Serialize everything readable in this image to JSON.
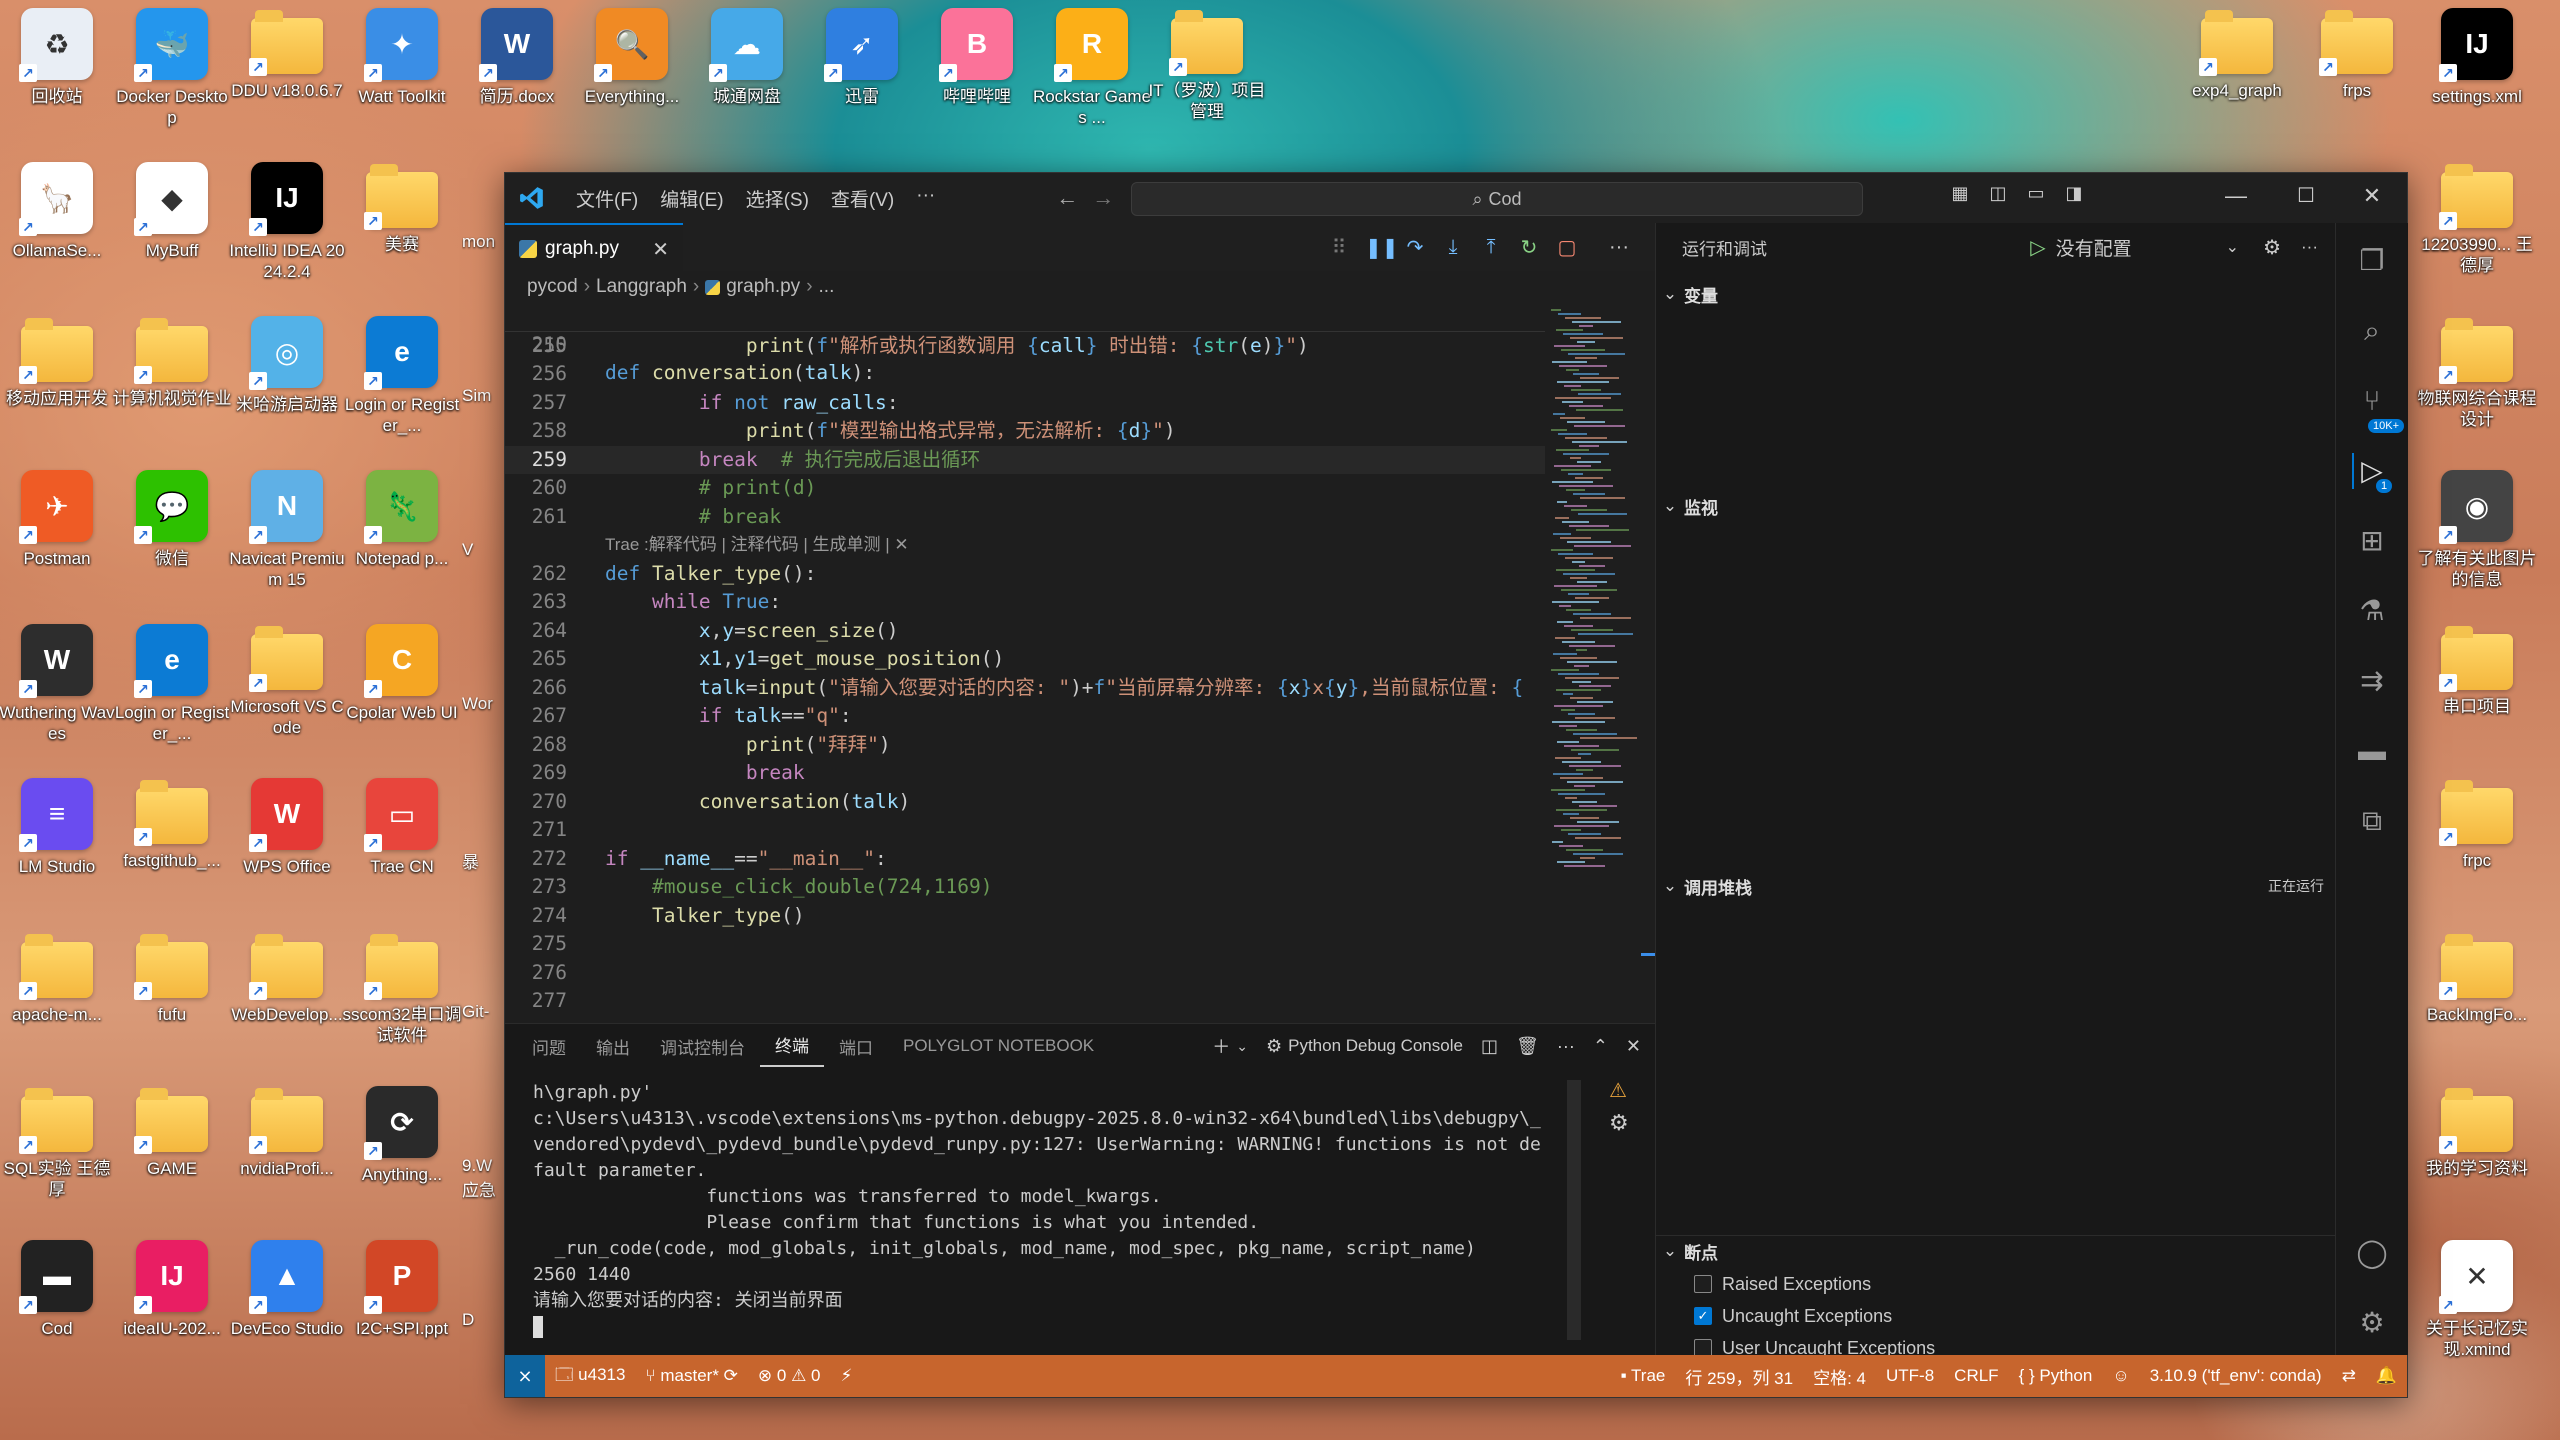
{
  "desktop": {
    "icons": [
      {
        "label": "回收站",
        "color": "#e9eef5",
        "glyph": "♻",
        "folder": false
      },
      {
        "label": "Docker Desktop",
        "color": "#2496ed",
        "glyph": "🐳",
        "folder": false
      },
      {
        "label": "DDU v18.0.6.7",
        "color": "",
        "glyph": "",
        "folder": true
      },
      {
        "label": "Watt Toolkit",
        "color": "#3a8ee6",
        "glyph": "✦",
        "folder": false
      },
      {
        "label": "简历.docx",
        "color": "#2b579a",
        "glyph": "W",
        "folder": false
      },
      {
        "label": "Everything...",
        "color": "#f08a24",
        "glyph": "🔍",
        "folder": false
      },
      {
        "label": "城通网盘",
        "color": "#46a9e8",
        "glyph": "☁",
        "folder": false
      },
      {
        "label": "迅雷",
        "color": "#2f7fe0",
        "glyph": "➶",
        "folder": false
      },
      {
        "label": "哔哩哔哩",
        "color": "#fb7299",
        "glyph": "B",
        "folder": false
      },
      {
        "label": "Rockstar Games ...",
        "color": "#fcaf17",
        "glyph": "R",
        "folder": false
      },
      {
        "label": "IT（罗波）项目管理",
        "color": "",
        "glyph": "",
        "folder": true
      },
      {
        "label": "OllamaSe...",
        "color": "#ffffff",
        "glyph": "🦙",
        "folder": false
      },
      {
        "label": "MyBuff",
        "color": "#ffffff",
        "glyph": "◆",
        "folder": false
      },
      {
        "label": "IntelliJ IDEA 2024.2.4",
        "color": "#000000",
        "glyph": "IJ",
        "folder": false
      },
      {
        "label": "美赛",
        "color": "",
        "glyph": "",
        "folder": true
      },
      {
        "label": "移动应用开发",
        "color": "",
        "glyph": "",
        "folder": true
      },
      {
        "label": "计算机视觉作业",
        "color": "",
        "glyph": "",
        "folder": true
      },
      {
        "label": "米哈游启动器",
        "color": "#53b2e8",
        "glyph": "◎",
        "folder": false
      },
      {
        "label": "Login or Register_...",
        "color": "#0c7bd4",
        "glyph": "e",
        "folder": false
      },
      {
        "label": "Postman",
        "color": "#ef5b25",
        "glyph": "✈",
        "folder": false
      },
      {
        "label": "微信",
        "color": "#2dc100",
        "glyph": "💬",
        "folder": false
      },
      {
        "label": "Navicat Premium 15",
        "color": "#5fb0e6",
        "glyph": "N",
        "folder": false
      },
      {
        "label": "Notepad p...",
        "color": "#7cb342",
        "glyph": "🦎",
        "folder": false
      },
      {
        "label": "Wuthering Waves",
        "color": "#2d2d2d",
        "glyph": "W",
        "folder": false
      },
      {
        "label": "Login or Register_...",
        "color": "#0c7bd4",
        "glyph": "e",
        "folder": false
      },
      {
        "label": "Microsoft VS Code",
        "color": "",
        "glyph": "",
        "folder": true
      },
      {
        "label": "Cpolar Web UI",
        "color": "#f5a623",
        "glyph": "C",
        "folder": false
      },
      {
        "label": "LM Studio",
        "color": "#6a4cf0",
        "glyph": "≡",
        "folder": false
      },
      {
        "label": "fastgithub_...",
        "color": "",
        "glyph": "",
        "folder": true
      },
      {
        "label": "WPS Office",
        "color": "#e53935",
        "glyph": "W",
        "folder": false
      },
      {
        "label": "Trae CN",
        "color": "#e8453c",
        "glyph": "▭",
        "folder": false
      },
      {
        "label": "apache-m...",
        "color": "",
        "glyph": "",
        "folder": true
      },
      {
        "label": "fufu",
        "color": "",
        "glyph": "",
        "folder": true
      },
      {
        "label": "WebDevelop...",
        "color": "",
        "glyph": "",
        "folder": true
      },
      {
        "label": "sscom32串口调试软件",
        "color": "",
        "glyph": "",
        "folder": true
      },
      {
        "label": "SQL实验 王德厚",
        "color": "",
        "glyph": "",
        "folder": true
      },
      {
        "label": "GAME",
        "color": "",
        "glyph": "",
        "folder": true
      },
      {
        "label": "nvidiaProfi...",
        "color": "",
        "glyph": "",
        "folder": true
      },
      {
        "label": "Anything...",
        "color": "#2a2a2a",
        "glyph": "⟳",
        "folder": false
      },
      {
        "label": "Cod",
        "color": "#222222",
        "glyph": "▬",
        "folder": false
      },
      {
        "label": "ideaIU-202...",
        "color": "#e91e63",
        "glyph": "IJ",
        "folder": false
      },
      {
        "label": "DevEco Studio",
        "color": "#2f80ed",
        "glyph": "▲",
        "folder": false
      },
      {
        "label": "I2C+SPI.ppt",
        "color": "#d24726",
        "glyph": "P",
        "folder": false
      }
    ],
    "partial_icons": [
      "mon",
      "Sim",
      "V",
      "Wor",
      "暴",
      "Git-",
      "9.W 应急",
      "D"
    ],
    "right_icons": [
      {
        "label": "exp4_graph",
        "color": "",
        "glyph": "",
        "folder": true
      },
      {
        "label": "frps",
        "color": "",
        "glyph": "",
        "folder": true
      },
      {
        "label": "settings.xml",
        "color": "#000000",
        "glyph": "IJ",
        "folder": false
      },
      {
        "label": "12203990... 王德厚",
        "color": "",
        "glyph": "",
        "folder": true
      },
      {
        "label": "物联网综合课程设计",
        "color": "",
        "glyph": "",
        "folder": true
      },
      {
        "label": "了解有关此图片的信息",
        "color": "#444444",
        "glyph": "◉",
        "folder": false
      },
      {
        "label": "串口项目",
        "color": "",
        "glyph": "",
        "folder": true
      },
      {
        "label": "frpc",
        "color": "",
        "glyph": "",
        "folder": true
      },
      {
        "label": "BackImgFo...",
        "color": "",
        "glyph": "",
        "folder": true
      },
      {
        "label": "我的学习资料",
        "color": "",
        "glyph": "",
        "folder": true
      },
      {
        "label": "关于长记忆实现.xmind",
        "color": "#ffffff",
        "glyph": "✕",
        "folder": false
      }
    ]
  },
  "vscode": {
    "menu": [
      "文件(F)",
      "编辑(E)",
      "选择(S)",
      "查看(V)",
      "···"
    ],
    "search_text": "Cod",
    "tab": {
      "name": "graph.py",
      "close": "✕"
    },
    "breadcrumb": [
      "pycod",
      "Langgraph",
      "graph.py",
      "..."
    ],
    "sticky_line": {
      "ln": "210",
      "code": "def conversation(talk):"
    },
    "lines": [
      {
        "ln": "255",
        "html": "            <span class='fn'>print</span>(<span class='kw'>f</span><span class='str'>\"解析或执行函数调用 </span><span class='kw'>{</span><span class='var'>call</span><span class='kw'>}</span><span class='str'> 时出错: </span><span class='kw'>{</span><span class='cls'>str</span>(<span class='var'>e</span>)<span class='kw'>}</span><span class='str'>\"</span>)"
      },
      {
        "ln": "256",
        "html": ""
      },
      {
        "ln": "257",
        "html": "        <span class='ctl'>if</span> <span class='kw'>not</span> <span class='var'>raw_calls</span>:"
      },
      {
        "ln": "258",
        "html": "            <span class='fn'>print</span>(<span class='kw'>f</span><span class='str'>\"模型输出格式异常，无法解析: </span><span class='kw'>{</span><span class='var'>d</span><span class='kw'>}</span><span class='str'>\"</span>)"
      },
      {
        "ln": "259",
        "html": "        <span class='ctl'>break</span>  <span class='cmt'># 执行完成后退出循环</span>",
        "current": true
      },
      {
        "ln": "260",
        "html": "        <span class='cmt'># print(d)</span>"
      },
      {
        "ln": "261",
        "html": "        <span class='cmt'># break</span>"
      },
      {
        "ln": "",
        "lens": "Trae :解释代码 | 注释代码 | 生成单测 | ✕"
      },
      {
        "ln": "262",
        "html": "<span class='kw'>def</span> <span class='fn'>Talker_type</span>():"
      },
      {
        "ln": "263",
        "html": "    <span class='ctl'>while</span> <span class='kw'>True</span>:"
      },
      {
        "ln": "264",
        "html": "        <span class='var'>x</span>,<span class='var'>y</span>=<span class='fn'>screen_size</span>()"
      },
      {
        "ln": "265",
        "html": "        <span class='var'>x1</span>,<span class='var'>y1</span>=<span class='fn'>get_mouse_position</span>()"
      },
      {
        "ln": "266",
        "html": "        <span class='var'>talk</span>=<span class='fn'>input</span>(<span class='str'>\"请输入您要对话的内容: \"</span>)+<span class='kw'>f</span><span class='str'>\"当前屏幕分辨率: </span><span class='kw'>{</span><span class='var'>x</span><span class='kw'>}</span><span class='str'>x</span><span class='kw'>{</span><span class='var'>y</span><span class='kw'>}</span><span class='str'>,当前鼠标位置: </span><span class='kw'>{</span>"
      },
      {
        "ln": "267",
        "html": "        <span class='ctl'>if</span> <span class='var'>talk</span>==<span class='str'>\"q\"</span>:"
      },
      {
        "ln": "268",
        "html": "            <span class='fn'>print</span>(<span class='str'>\"拜拜\"</span>)"
      },
      {
        "ln": "269",
        "html": "            <span class='ctl'>break</span>"
      },
      {
        "ln": "270",
        "html": "        <span class='fn'>conversation</span>(<span class='var'>talk</span>)"
      },
      {
        "ln": "271",
        "html": ""
      },
      {
        "ln": "272",
        "html": "<span class='ctl'>if</span> <span class='var'>__name__</span>==<span class='str'>\"__main__\"</span>:"
      },
      {
        "ln": "273",
        "html": "    <span class='cmt'>#mouse_click_double(724,1169)</span>"
      },
      {
        "ln": "274",
        "html": "    <span class='fn'>Talker_type</span>()"
      },
      {
        "ln": "275",
        "html": ""
      },
      {
        "ln": "276",
        "html": ""
      },
      {
        "ln": "277",
        "html": ""
      }
    ],
    "panel_tabs": [
      "问题",
      "输出",
      "调试控制台",
      "终端",
      "端口",
      "POLYGLOT NOTEBOOK"
    ],
    "panel_active": "终端",
    "debug_console_label": "Python Debug Console",
    "terminal_lines": [
      "h\\graph.py'",
      "c:\\Users\\u4313\\.vscode\\extensions\\ms-python.debugpy-2025.8.0-win32-x64\\bundled\\libs\\debugpy\\_",
      "vendored\\pydevd\\_pydevd_bundle\\pydevd_runpy.py:127: UserWarning: WARNING! functions is not de",
      "fault parameter.",
      "                functions was transferred to model_kwargs.",
      "                Please confirm that functions is what you intended.",
      "  _run_code(code, mod_globals, init_globals, mod_name, mod_spec, pkg_name, script_name)",
      "2560 1440",
      "请输入您要对话的内容: 关闭当前界面"
    ],
    "sidebar": {
      "title": "运行和调试",
      "config": "没有配置",
      "sections": {
        "variables": "变量",
        "watch": "监视",
        "callstack": "调用堆栈",
        "callstack_status": "正在运行",
        "breakpoints": "断点"
      },
      "breakpoints": [
        {
          "label": "Raised Exceptions",
          "checked": false
        },
        {
          "label": "Uncaught Exceptions",
          "checked": true
        },
        {
          "label": "User Uncaught Exceptions",
          "checked": false
        }
      ]
    },
    "activity_badges": {
      "source_control": "10K+",
      "run_debug": "1"
    },
    "status": {
      "user": "u4313",
      "branch": "master*",
      "errors": "0",
      "warnings": "0",
      "trae": "Trae",
      "position": "行 259，列 31",
      "spaces": "空格: 4",
      "encoding": "UTF-8",
      "eol": "CRLF",
      "language": "Python",
      "interpreter": "3.10.9 ('tf_env': conda)"
    },
    "colors": {
      "status_bar": "#c7652d",
      "accent": "#0078d4"
    }
  }
}
